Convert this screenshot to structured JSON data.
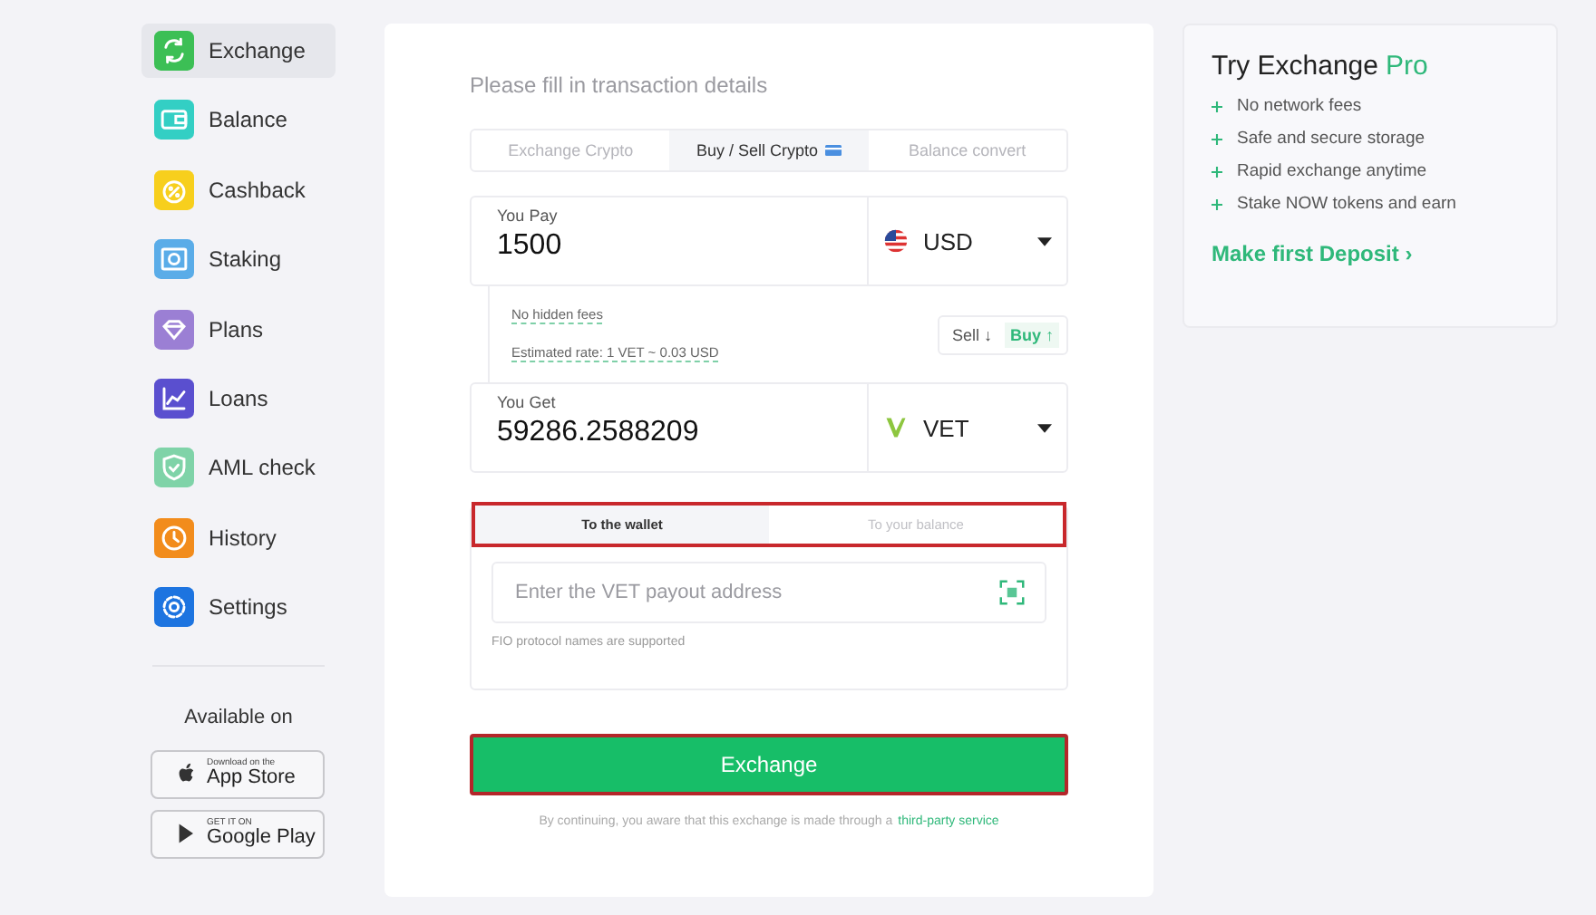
{
  "sidebar": {
    "items": [
      {
        "label": "Exchange",
        "color": "#3cbf55",
        "selected": true
      },
      {
        "label": "Balance",
        "color": "#33cfc4",
        "selected": false
      },
      {
        "label": "Cashback",
        "color": "#f7cf1d",
        "selected": false
      },
      {
        "label": "Staking",
        "color": "#5aace8",
        "selected": false
      },
      {
        "label": "Plans",
        "color": "#9b7fd4",
        "selected": false
      },
      {
        "label": "Loans",
        "color": "#5a4fcf",
        "selected": false
      },
      {
        "label": "AML check",
        "color": "#7fd3a8",
        "selected": false
      },
      {
        "label": "History",
        "color": "#f28c1c",
        "selected": false
      },
      {
        "label": "Settings",
        "color": "#1d74e0",
        "selected": false
      }
    ]
  },
  "available_on": {
    "label": "Available on",
    "badges": [
      {
        "kind": "apple",
        "small": "Download on the",
        "big": "App Store"
      },
      {
        "kind": "google",
        "small": "GET IT ON",
        "big": "Google Play"
      }
    ]
  },
  "form": {
    "title": "Please fill in transaction details",
    "tabs": [
      {
        "label": "Exchange Crypto",
        "selected": false
      },
      {
        "label": "Buy / Sell Crypto",
        "selected": true,
        "card_icon": true
      },
      {
        "label": "Balance convert",
        "selected": false
      }
    ],
    "pay": {
      "label": "You Pay",
      "value": "1500",
      "currency": "USD"
    },
    "notes": [
      "No hidden fees",
      "Estimated rate: 1 VET ~ 0.03 USD"
    ],
    "direction": [
      {
        "label": "Sell ↓",
        "selected": false
      },
      {
        "label": "Buy ↑",
        "selected": true
      }
    ],
    "get": {
      "label": "You Get",
      "value": "59286.2588209",
      "currency": "VET"
    },
    "destination_tabs": [
      {
        "label": "To the wallet",
        "selected": true
      },
      {
        "label": "To your balance",
        "selected": false
      }
    ],
    "address": {
      "placeholder": "Enter the VET payout address",
      "hint": "FIO protocol names are supported"
    },
    "button": "Exchange",
    "footer": {
      "text": "By continuing, you aware that this exchange is made through a",
      "link": "third-party service"
    }
  },
  "promo": {
    "title": "Try Exchange",
    "title_accent": "Pro",
    "features": [
      "No network fees",
      "Safe and secure storage",
      "Rapid exchange anytime",
      "Stake NOW tokens and earn"
    ],
    "link": "Make first Deposit ›"
  }
}
